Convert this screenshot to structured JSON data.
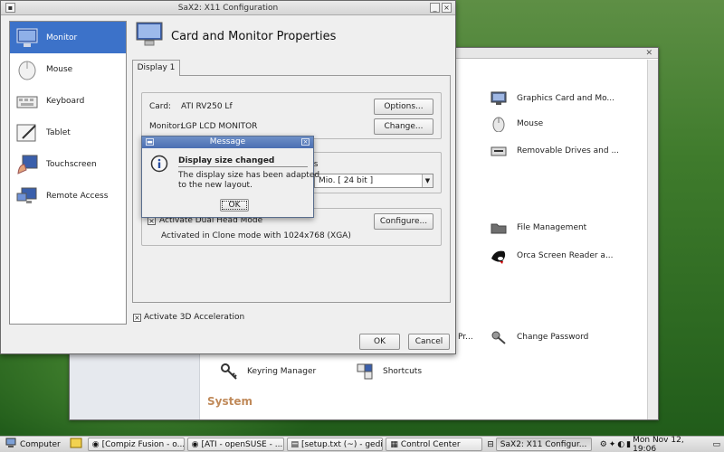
{
  "sax": {
    "title": "SaX2: X11 Configuration",
    "nav": [
      {
        "label": "Monitor",
        "icon": "monitor-icon"
      },
      {
        "label": "Mouse",
        "icon": "mouse-icon"
      },
      {
        "label": "Keyboard",
        "icon": "keyboard-icon"
      },
      {
        "label": "Tablet",
        "icon": "tablet-icon"
      },
      {
        "label": "Touchscreen",
        "icon": "touchscreen-icon"
      },
      {
        "label": "Remote Access",
        "icon": "remote-access-icon"
      }
    ],
    "heading": "Card and Monitor Properties",
    "tab": "Display 1",
    "card_label": "Card:",
    "card_value": "ATI RV250 Lf",
    "monitor_label": "Monitor:",
    "monitor_value": "LGP LCD MONITOR",
    "options_button": "Options...",
    "change_button": "Change...",
    "partial_label": "rs",
    "color_combo": "Mio. [ 24 bit ]",
    "dual_head_checkbox": "Activate Dual Head Mode",
    "configure_button": "Configure...",
    "clone_info": "Activated in Clone mode with 1024x768 (XGA)",
    "accel_checkbox": "Activate 3D Acceleration",
    "ok_button": "OK",
    "cancel_button": "Cancel"
  },
  "message": {
    "title": "Message",
    "heading": "Display size changed",
    "body_line1": "The display size has been adapted",
    "body_line2": "to the new layout.",
    "ok_button": "OK"
  },
  "control_center": {
    "items": [
      {
        "label": "Graphics Card and Mo...",
        "icon": "graphics-card-icon"
      },
      {
        "label": "Mouse",
        "icon": "mouse-icon"
      },
      {
        "label": "Removable Drives and ...",
        "icon": "removable-drives-icon"
      },
      {
        "label": "File Management",
        "icon": "folder-icon"
      },
      {
        "label": "Orca Screen Reader a...",
        "icon": "orca-icon"
      },
      {
        "label": "Change Password",
        "icon": "password-icon"
      },
      {
        "label": "Keyring Manager",
        "icon": "keyring-icon"
      },
      {
        "label": "Shortcuts",
        "icon": "shortcuts-icon"
      }
    ],
    "partial_text": "Pr...",
    "section": "System"
  },
  "taskbar": {
    "computer": "Computer",
    "tasks": [
      "[Compiz Fusion - o...",
      "[ATI - openSUSE - ...",
      "[setup.txt (~) - gedit]",
      "Control Center",
      "SaX2: X11 Configur..."
    ],
    "clock": "Mon Nov 12, 19:06"
  }
}
